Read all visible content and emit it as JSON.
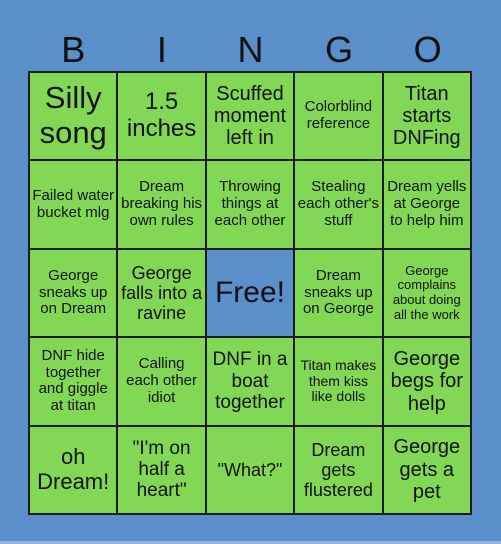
{
  "header": {
    "letters": [
      "B",
      "I",
      "N",
      "G",
      "O"
    ]
  },
  "colors": {
    "background": "#5b8fc9",
    "cell": "#82d855",
    "free_cell": "#5b8fc9",
    "border": "#1c1c1c"
  },
  "rows": [
    [
      "Silly song",
      "1.5 inches",
      "Scuffed moment left in",
      "Colorblind reference",
      "Titan starts DNFing"
    ],
    [
      "Failed water bucket mlg",
      "Dream breaking his own rules",
      "Throwing things at each other",
      "Stealing each other's stuff",
      "Dream yells at George to help him"
    ],
    [
      "George sneaks up on Dream",
      "George falls into a ravine",
      "Free!",
      "Dream sneaks up on George",
      "George complains about doing all the work"
    ],
    [
      "DNF hide together and giggle at titan",
      "Calling each other idiot",
      "DNF in a boat together",
      "Titan makes them kiss like dolls",
      "George begs for help"
    ],
    [
      "oh Dream!",
      "\"I'm on half a heart\"",
      "\"What?\"",
      "Dream gets flustered",
      "George gets a pet"
    ]
  ],
  "free_space": {
    "row": 2,
    "col": 2
  }
}
